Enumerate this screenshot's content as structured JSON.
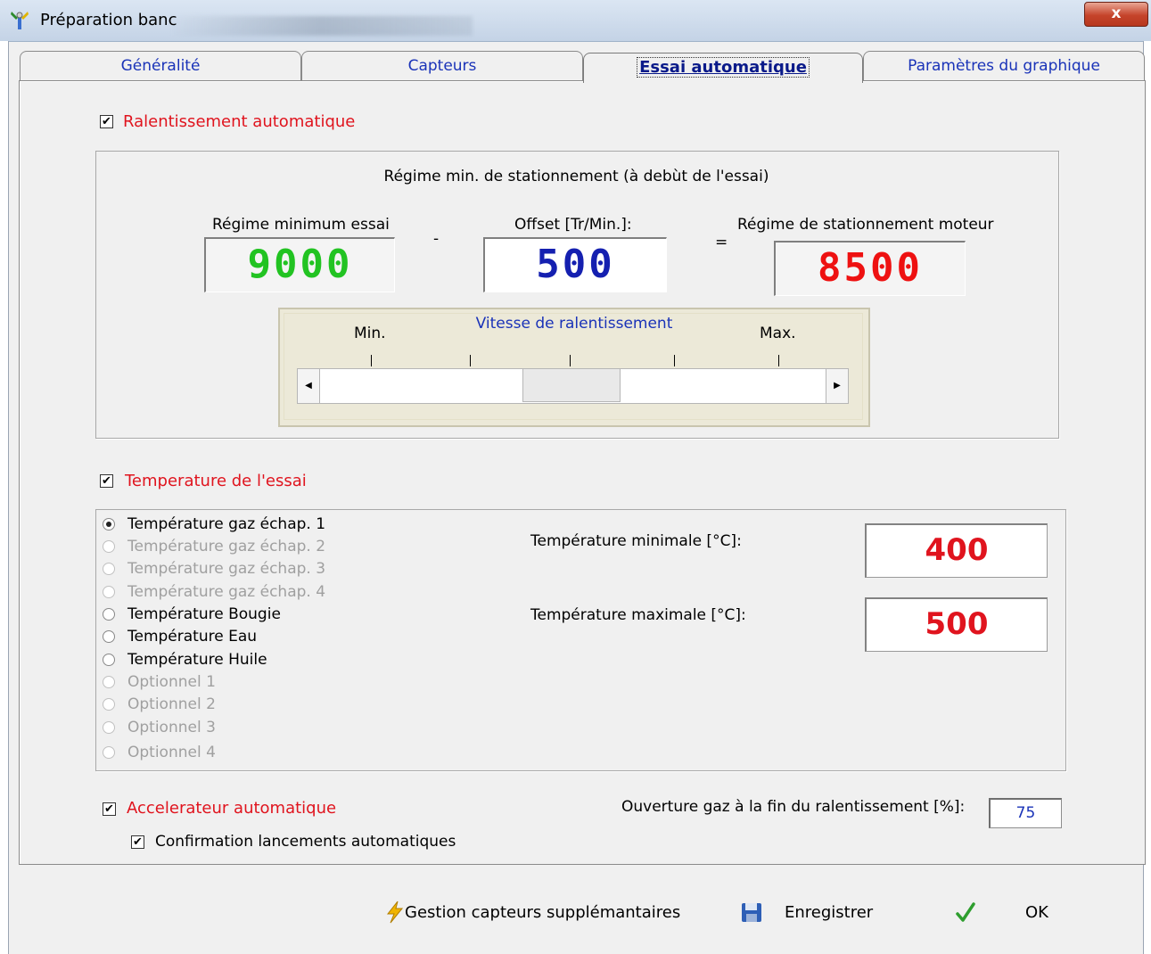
{
  "window": {
    "title": "Préparation banc",
    "close_label": "x"
  },
  "tabs": [
    {
      "label": "Généralité"
    },
    {
      "label": "Capteurs"
    },
    {
      "label": "Essai automatique"
    },
    {
      "label": "Paramètres du graphique"
    }
  ],
  "ralentissement": {
    "checkbox_label": "Ralentissement automatique",
    "checked": true,
    "group_title": "Régime min. de stationnement (à debùt de l'essai)",
    "min_label": "Régime minimum essai",
    "min_value": "9000",
    "min_color": "#22c322",
    "minus_sign": "-",
    "offset_label": "Offset [Tr/Min.]:",
    "offset_value": "500",
    "offset_color": "#1520b0",
    "equals_sign": "=",
    "result_label": "Régime de stationnement moteur",
    "result_value": "8500",
    "result_color": "#ee1111",
    "slider": {
      "title": "Vitesse de ralentissement",
      "min_label": "Min.",
      "max_label": "Max.",
      "position_fraction": 0.5
    }
  },
  "temperature": {
    "checkbox_label": "Temperature de l'essai",
    "checked": true,
    "options": [
      {
        "label": "Température gaz échap. 1",
        "selected": true,
        "enabled": true
      },
      {
        "label": "Température gaz échap. 2",
        "selected": false,
        "enabled": false
      },
      {
        "label": "Température gaz échap. 3",
        "selected": false,
        "enabled": false
      },
      {
        "label": "Température gaz échap. 4",
        "selected": false,
        "enabled": false
      },
      {
        "label": "Température Bougie",
        "selected": false,
        "enabled": true
      },
      {
        "label": "Température Eau",
        "selected": false,
        "enabled": true
      },
      {
        "label": "Température Huile",
        "selected": false,
        "enabled": true
      },
      {
        "label": "Optionnel 1",
        "selected": false,
        "enabled": false
      },
      {
        "label": "Optionnel 2",
        "selected": false,
        "enabled": false
      },
      {
        "label": "Optionnel 3",
        "selected": false,
        "enabled": false
      },
      {
        "label": "Optionnel 4",
        "selected": false,
        "enabled": false
      }
    ],
    "min_label": "Température minimale [°C]:",
    "min_value": "400",
    "max_label": "Température maximale [°C]:",
    "max_value": "500"
  },
  "accelerateur": {
    "checkbox_label": "Accelerateur automatique",
    "checked": true,
    "confirmation_label": "Confirmation lancements automatiques",
    "confirmation_checked": true,
    "ouverture_label": "Ouverture gaz à la fin du ralentissement [%]:",
    "ouverture_value": "75"
  },
  "buttons": {
    "gestion": "Gestion capteurs supplémantaires",
    "enregistrer": "Enregistrer",
    "ok": "OK"
  },
  "icons": {
    "app": "tools-icon",
    "gestion": "lightning-icon",
    "enregistrer": "floppy-disk-icon",
    "ok": "checkmark-icon"
  }
}
